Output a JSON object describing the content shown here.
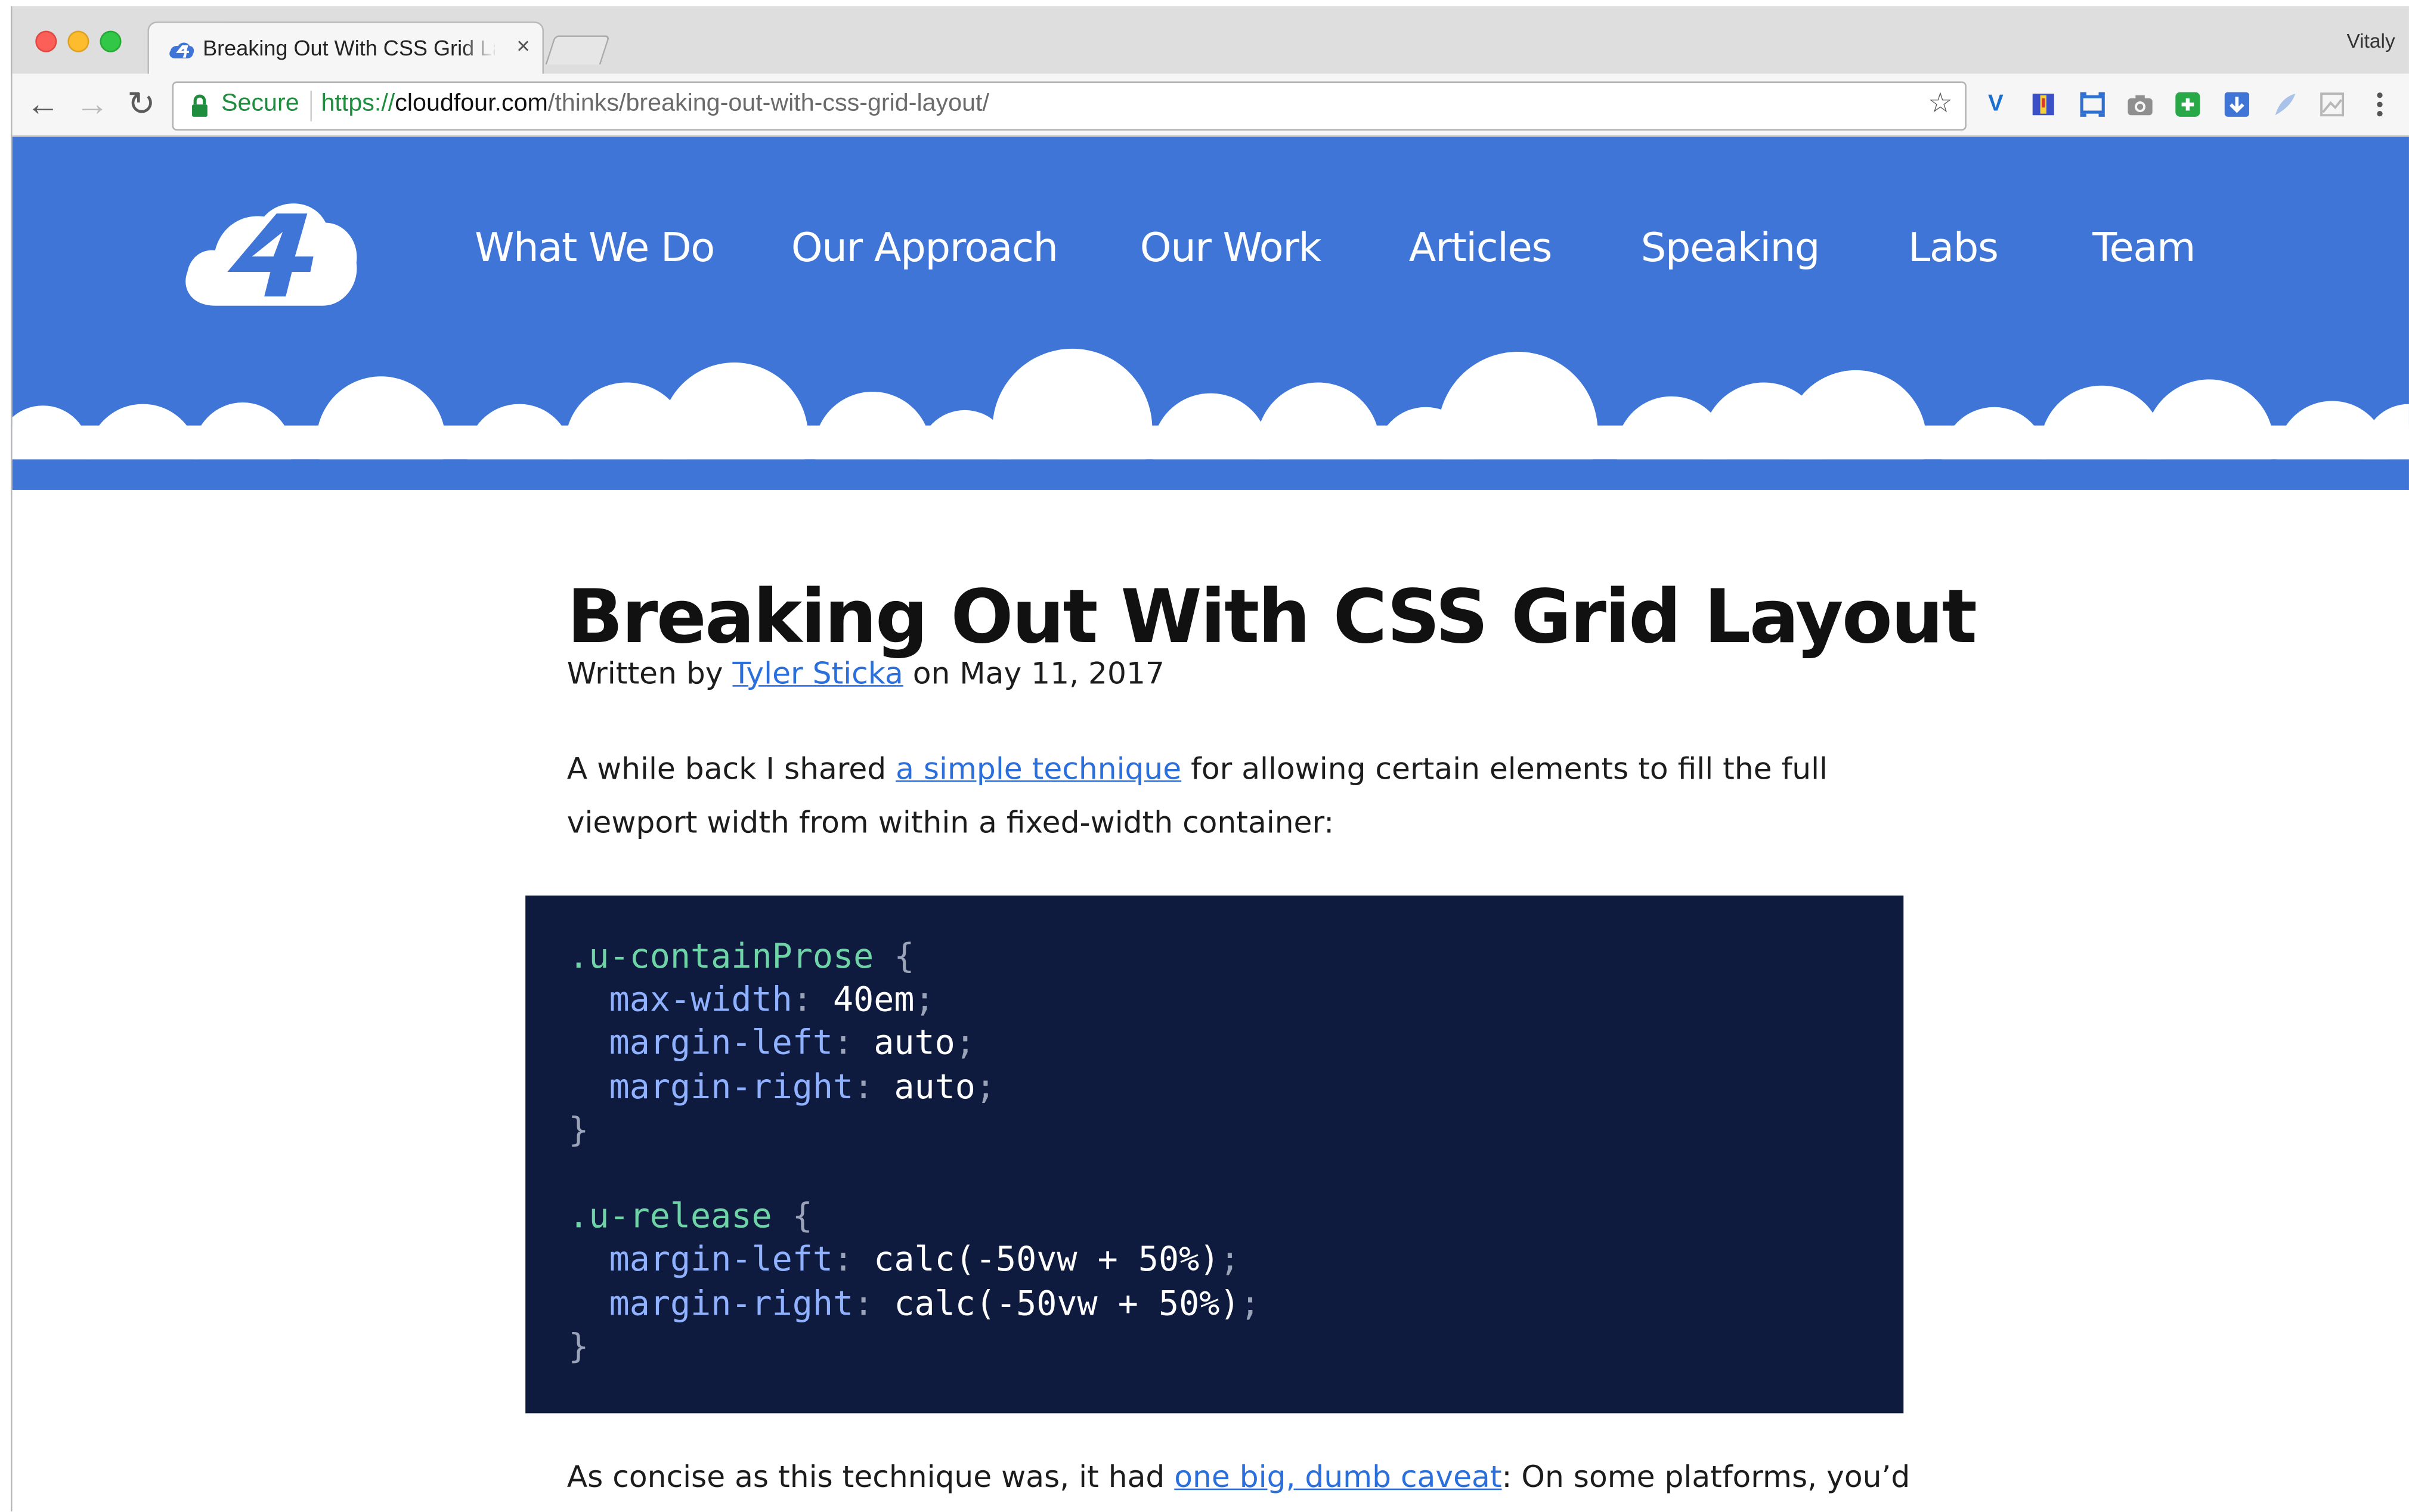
{
  "browser": {
    "tab_title": "Breaking Out With CSS Grid Layout",
    "tab_close_glyph": "×",
    "profile_name": "Vitaly",
    "back_glyph": "←",
    "forward_glyph": "→",
    "reload_glyph": "↻",
    "secure_label": "Secure",
    "url": {
      "protocol": "https://",
      "host": "cloudfour.com",
      "path": "/thinks/breaking-out-with-css-grid-layout/"
    },
    "bookmark_glyph": "☆",
    "extensions": [
      "vivaldi-icon",
      "flag-icon",
      "resize-icon",
      "camera-icon",
      "refresh-plus-icon",
      "download-icon",
      "feather-icon",
      "image-icon",
      "menu-icon"
    ]
  },
  "site": {
    "nav": [
      "What We Do",
      "Our Approach",
      "Our Work",
      "Articles",
      "Speaking",
      "Labs",
      "Team"
    ],
    "brand_color": "#3f75d6"
  },
  "article": {
    "title": "Breaking Out With CSS Grid Layout",
    "byline": {
      "prefix": "Written by ",
      "author": "Tyler Sticka",
      "suffix": " on May 11, 2017"
    },
    "p1": {
      "before": "A while back I shared ",
      "link": "a simple technique",
      "after": " for allowing certain elements to fill the full viewport width from within a fixed-width container:"
    },
    "code": {
      "selector1": ".u-containProse",
      "prop1": "max-width",
      "val1": "40em",
      "prop2": "margin-left",
      "val2": "auto",
      "prop3": "margin-right",
      "val3": "auto",
      "selector2": ".u-release",
      "prop4": "margin-left",
      "val4": "calc(-50vw + 50%)",
      "prop5": "margin-right",
      "val5": "calc(-50vw + 50%)"
    },
    "p2": {
      "before": "As concise as this technique was, it had ",
      "link": "one big, dumb caveat",
      "after": ": On some platforms, you’d"
    }
  }
}
